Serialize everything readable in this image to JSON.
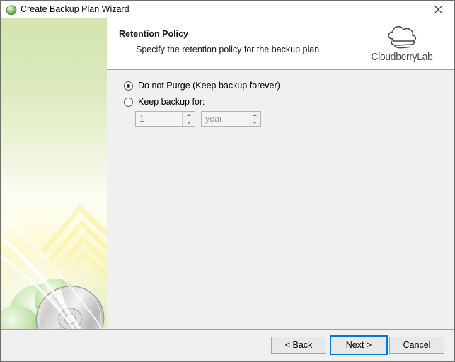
{
  "window": {
    "title": "Create Backup Plan Wizard",
    "title_icon": "green-cloud-icon",
    "close_icon": "close-icon"
  },
  "header": {
    "title": "Retention Policy",
    "subtitle": "Specify the retention policy for the backup plan",
    "logo_text": "CloudberryLab",
    "logo_icon": "cloudberry-cloud-icon"
  },
  "sidebar": {
    "art_name": "wizard-banner-disc-cloud-artwork",
    "gradient_top": "#d4e5b0",
    "gradient_bottom": "#dff0c2"
  },
  "options": [
    {
      "id": "do-not-purge",
      "label": "Do not Purge (Keep backup forever)",
      "selected": true
    },
    {
      "id": "keep-backup-for",
      "label": "Keep backup for:",
      "selected": false
    }
  ],
  "retention": {
    "amount_value": "1",
    "amount_placeholder": "1",
    "unit_value": "year",
    "unit_placeholder": "year",
    "enabled": false
  },
  "footer": {
    "back_label": "< Back",
    "next_label": "Next >",
    "cancel_label": "Cancel",
    "default_button": "Next >",
    "focus_color": "#0078d7"
  }
}
